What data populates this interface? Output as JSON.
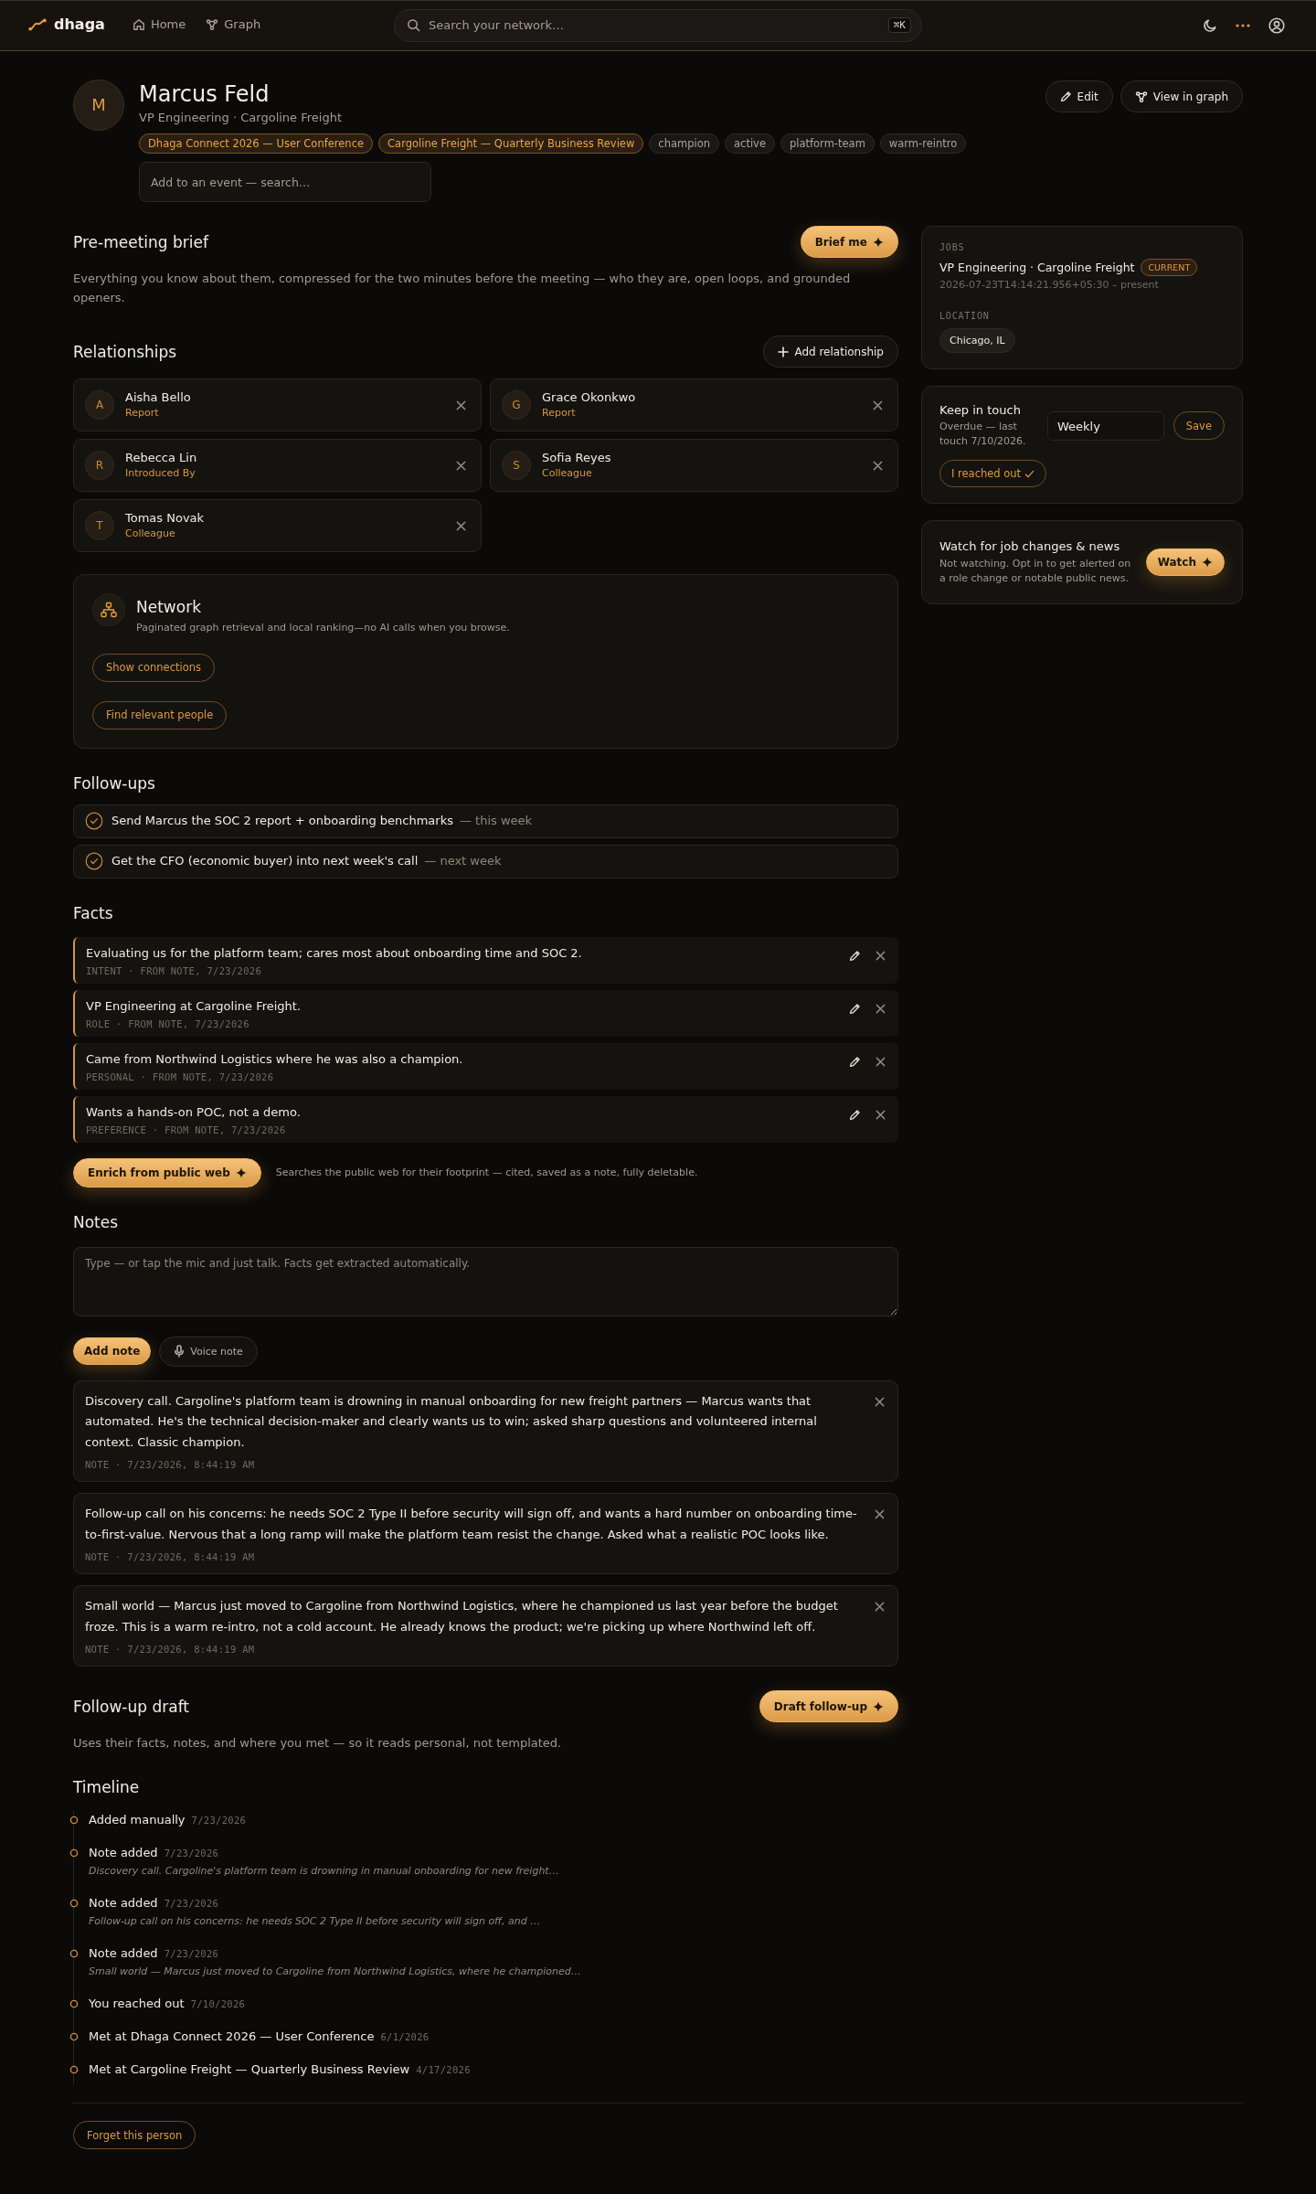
{
  "nav": {
    "brand": "dhaga",
    "links": [
      {
        "label": "Home"
      },
      {
        "label": "Graph"
      }
    ],
    "search": {
      "placeholder": "Search your network…",
      "shortcut": "⌘K"
    }
  },
  "profile": {
    "initial": "M",
    "name": "Marcus Feld",
    "subtitle": "VP Engineering · Cargoline Freight",
    "tags": [
      {
        "label": "Dhaga Connect 2026 — User Conference",
        "kind": "event"
      },
      {
        "label": "Cargoline Freight — Quarterly Business Review",
        "kind": "event"
      },
      {
        "label": "champion",
        "kind": "tag"
      },
      {
        "label": "active",
        "kind": "tag"
      },
      {
        "label": "platform-team",
        "kind": "tag"
      },
      {
        "label": "warm-reintro",
        "kind": "tag"
      }
    ],
    "event_search": {
      "placeholder": "Add to an event — search…"
    },
    "actions": [
      "Edit",
      "View in graph"
    ]
  },
  "brief": {
    "title": "Pre-meeting brief",
    "button": "Brief me",
    "description": "Everything you know about them, compressed for the two minutes before the meeting — who they are, open loops, and grounded openers."
  },
  "relationships": {
    "title": "Relationships",
    "add_button": "Add relationship",
    "people": [
      {
        "initial": "A",
        "name": "Aisha Bello",
        "role": "Report"
      },
      {
        "initial": "G",
        "name": "Grace Okonkwo",
        "role": "Report"
      },
      {
        "initial": "R",
        "name": "Rebecca Lin",
        "role": "Introduced By"
      },
      {
        "initial": "S",
        "name": "Sofia Reyes",
        "role": "Colleague"
      },
      {
        "initial": "T",
        "name": "Tomas Novak",
        "role": "Colleague"
      }
    ]
  },
  "network": {
    "title": "Network",
    "description": "Paginated graph retrieval and local ranking—no AI calls when you browse.",
    "buttons": [
      "Show connections",
      "Find relevant people"
    ]
  },
  "follow_ups": {
    "title": "Follow-ups",
    "items": [
      {
        "text": "Send Marcus the SOC 2 report + onboarding benchmarks",
        "due": "— this week"
      },
      {
        "text": "Get the CFO (economic buyer) into next week's call",
        "due": "— next week"
      }
    ]
  },
  "facts": {
    "title": "Facts",
    "items": [
      {
        "text": "Evaluating us for the platform team; cares most about onboarding time and SOC 2.",
        "meta": "INTENT · FROM NOTE, 7/23/2026"
      },
      {
        "text": "VP Engineering at Cargoline Freight.",
        "meta": "ROLE · FROM NOTE, 7/23/2026"
      },
      {
        "text": "Came from Northwind Logistics where he was also a champion.",
        "meta": "PERSONAL · FROM NOTE, 7/23/2026"
      },
      {
        "text": "Wants a hands-on POC, not a demo.",
        "meta": "PREFERENCE · FROM NOTE, 7/23/2026"
      }
    ],
    "enrich_button": "Enrich from public web",
    "enrich_note": "Searches the public web for their footprint — cited, saved as a note, fully deletable."
  },
  "notes": {
    "title": "Notes",
    "input": {
      "placeholder": "Type — or tap the mic and just talk. Facts get extracted automatically."
    },
    "add_button": "Add note",
    "voice_button": "Voice note",
    "items": [
      {
        "text": "Discovery call. Cargoline's platform team is drowning in manual onboarding for new freight partners — Marcus wants that automated. He's the technical decision-maker and clearly wants us to win; asked sharp questions and volunteered internal context. Classic champion.",
        "meta": "NOTE · 7/23/2026, 8:44:19 AM"
      },
      {
        "text": "Follow-up call on his concerns: he needs SOC 2 Type II before security will sign off, and wants a hard number on onboarding time-to-first-value. Nervous that a long ramp will make the platform team resist the change. Asked what a realistic POC looks like.",
        "meta": "NOTE · 7/23/2026, 8:44:19 AM"
      },
      {
        "text": "Small world — Marcus just moved to Cargoline from Northwind Logistics, where he championed us last year before the budget froze. This is a warm re-intro, not a cold account. He already knows the product; we're picking up where Northwind left off.",
        "meta": "NOTE · 7/23/2026, 8:44:19 AM"
      }
    ]
  },
  "follow_up_draft": {
    "title": "Follow-up draft",
    "button": "Draft follow-up",
    "description": "Uses their facts, notes, and where you met — so it reads personal, not templated."
  },
  "timeline": {
    "title": "Timeline",
    "events": [
      {
        "title": "Added manually",
        "date": "7/23/2026"
      },
      {
        "title": "Note added",
        "date": "7/23/2026",
        "preview": "Discovery call. Cargoline's platform team is drowning in manual onboarding for new freight…"
      },
      {
        "title": "Note added",
        "date": "7/23/2026",
        "preview": "Follow-up call on his concerns: he needs SOC 2 Type II before security will sign off, and …"
      },
      {
        "title": "Note added",
        "date": "7/23/2026",
        "preview": "Small world — Marcus just moved to Cargoline from Northwind Logistics, where he championed…"
      },
      {
        "title": "You reached out",
        "date": "7/10/2026"
      },
      {
        "title": "Met at Dhaga Connect 2026 — User Conference",
        "date": "6/1/2026"
      },
      {
        "title": "Met at Cargoline Freight — Quarterly Business Review",
        "date": "4/17/2026"
      }
    ]
  },
  "forget_button": "Forget this person",
  "jobs": {
    "label": "JOBS",
    "title": "VP Engineering · Cargoline Freight",
    "badge": "CURRENT",
    "dates": "2026-07-23T14:14:21.956+05:30 – present",
    "location_label": "LOCATION",
    "location": "Chicago, IL"
  },
  "keep_in_touch": {
    "title": "Keep in touch",
    "status": "Overdue — last touch 7/10/2026.",
    "frequency": {
      "value": "Weekly"
    },
    "save_button": "Save",
    "reached_out_button": "I reached out"
  },
  "watch": {
    "title": "Watch for job changes & news",
    "description": "Not watching. Opt in to get alerted on a role change or notable public news.",
    "button": "Watch"
  }
}
